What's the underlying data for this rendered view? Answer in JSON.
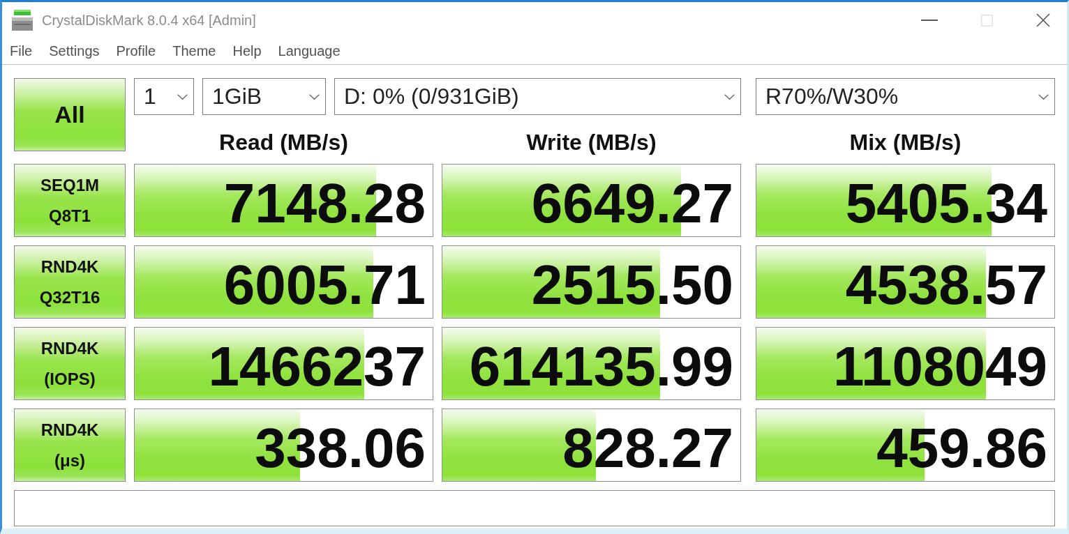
{
  "window": {
    "title": "CrystalDiskMark 8.0.4 x64 [Admin]",
    "buttons": [
      {
        "kind": "minimize",
        "disabled": false
      },
      {
        "kind": "maximize",
        "disabled": true
      },
      {
        "kind": "close",
        "disabled": false
      }
    ]
  },
  "menu": [
    "File",
    "Settings",
    "Profile",
    "Theme",
    "Help",
    "Language"
  ],
  "all_button": {
    "label": "All"
  },
  "settings": [
    {
      "kind": "count",
      "value": "1"
    },
    {
      "kind": "size",
      "value": "1GiB"
    },
    {
      "kind": "drive",
      "value": "D: 0% (0/931GiB)"
    }
  ],
  "mix_setting": {
    "value": "R70%/W30%"
  },
  "columns": [
    "Read (MB/s)",
    "Write (MB/s)",
    "Mix (MB/s)"
  ],
  "tests": [
    {
      "label_lines": [
        "SEQ1M",
        "Q8T1"
      ],
      "results": [
        {
          "value": "7148.28",
          "level": 0.81
        },
        {
          "value": "6649.27",
          "level": 0.8
        },
        {
          "value": "5405.34",
          "level": 0.79
        }
      ]
    },
    {
      "label_lines": [
        "RND4K",
        "Q32T16"
      ],
      "results": [
        {
          "value": "6005.71",
          "level": 0.8
        },
        {
          "value": "2515.50",
          "level": 0.73
        },
        {
          "value": "4538.57",
          "level": 0.77
        }
      ]
    },
    {
      "label_lines": [
        "RND4K",
        "(IOPS)"
      ],
      "results": [
        {
          "value": "1466237",
          "level": 0.77
        },
        {
          "value": "614135.99",
          "level": 0.73
        },
        {
          "value": "1108049",
          "level": 0.77
        }
      ]
    },
    {
      "label_lines": [
        "RND4K",
        "(μs)"
      ],
      "results": [
        {
          "value": "338.06",
          "level": 0.555
        },
        {
          "value": "828.27",
          "level": 0.515
        },
        {
          "value": "459.86",
          "level": 0.565
        }
      ]
    }
  ]
}
